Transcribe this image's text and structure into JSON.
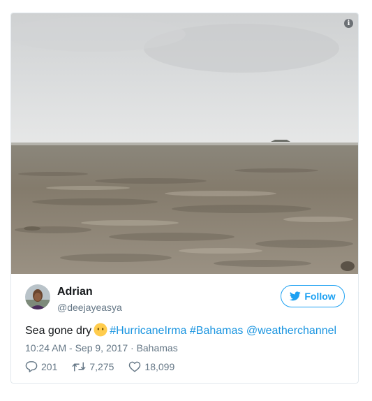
{
  "tweet": {
    "info_icon": "info-icon",
    "author": {
      "name": "Adrian",
      "handle": "@deejayeasya"
    },
    "follow_button": {
      "label": "Follow",
      "icon": "twitter-bird-icon"
    },
    "text": {
      "plain": "Sea gone dry",
      "emoji": "neutral-face-emoji",
      "hashtag_1": "#HurricaneIrma",
      "hashtag_2": "#Bahamas",
      "mention": "@weatherchannel"
    },
    "meta": {
      "time": "10:24 AM - Sep 9, 2017",
      "separator": "·",
      "location": "Bahamas"
    },
    "stats": {
      "replies": "201",
      "retweets": "7,275",
      "likes": "18,099"
    },
    "colors": {
      "accent": "#1da1f2",
      "link": "#1b95e0",
      "text": "#14171a",
      "secondary": "#657786",
      "border": "#e1e8ed"
    }
  }
}
